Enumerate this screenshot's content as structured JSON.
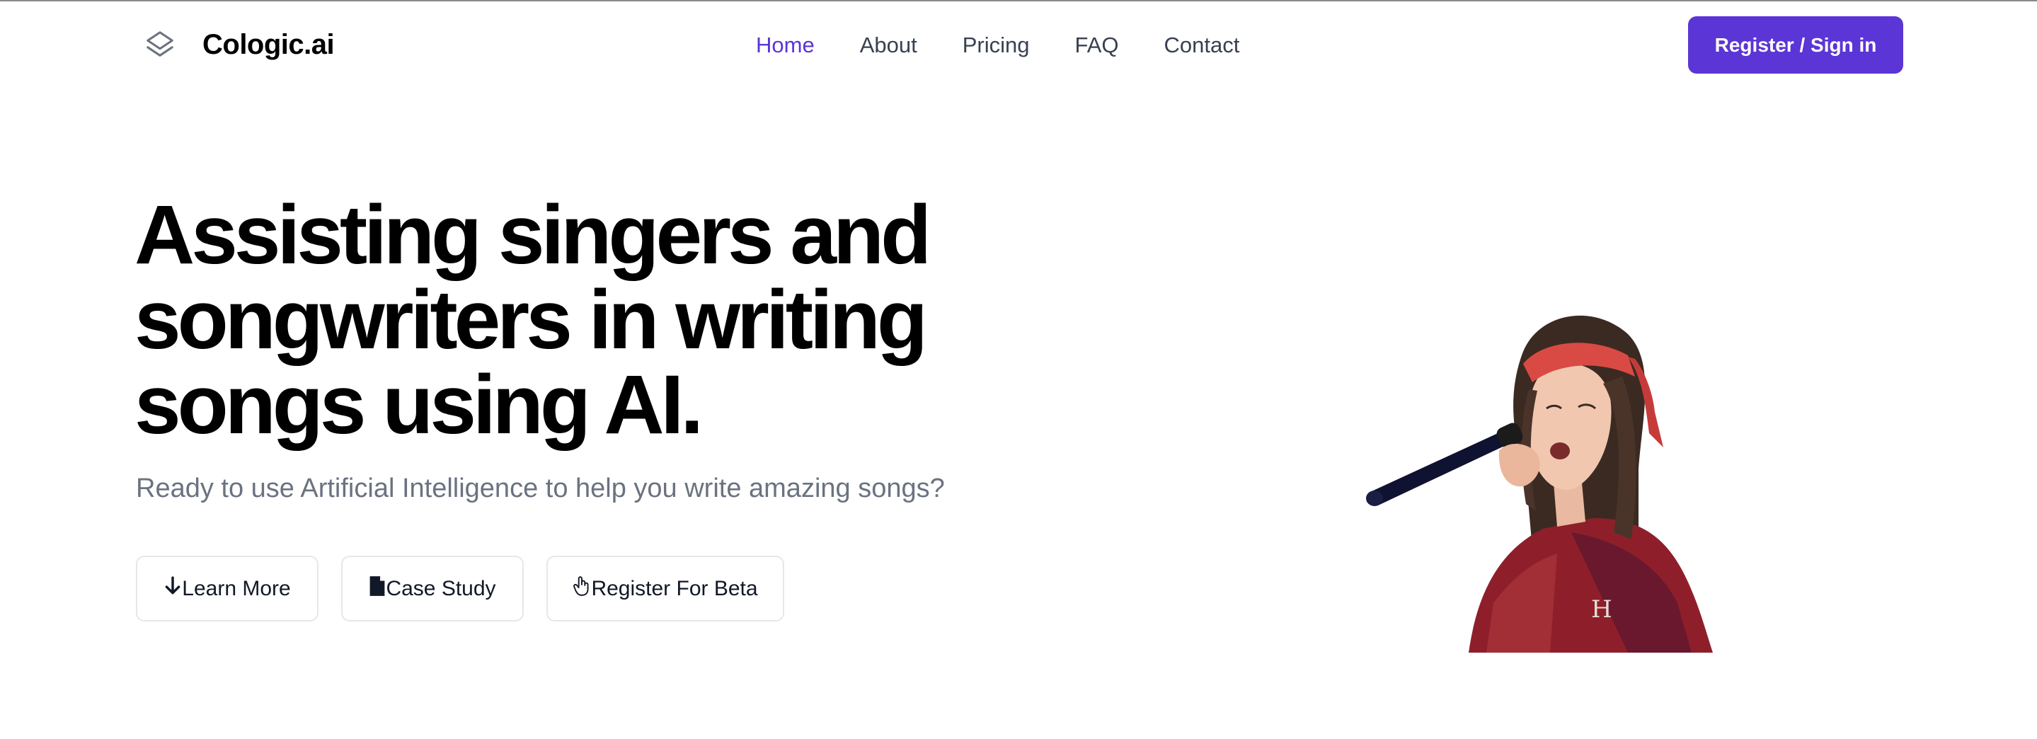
{
  "brand": {
    "name": "Cologic.ai",
    "icon": "layers-icon"
  },
  "nav": {
    "items": [
      {
        "label": "Home",
        "active": true
      },
      {
        "label": "About",
        "active": false
      },
      {
        "label": "Pricing",
        "active": false
      },
      {
        "label": "FAQ",
        "active": false
      },
      {
        "label": "Contact",
        "active": false
      }
    ],
    "cta_label": "Register / Sign in"
  },
  "hero": {
    "title_lines": [
      "Assisting singers and",
      "songwriters in writing",
      "songs using AI."
    ],
    "subtitle": "Ready to use Artificial Intelligence to help you write amazing songs?",
    "buttons": [
      {
        "label": "Learn More",
        "icon": "arrow-down-icon"
      },
      {
        "label": "Case Study",
        "icon": "document-icon"
      },
      {
        "label": "Register For Beta",
        "icon": "hand-pointer-icon"
      }
    ],
    "image": "singer-with-microphone"
  },
  "colors": {
    "accent": "#5b35d5",
    "title": "#000000",
    "subtitle": "#6b7280",
    "nav_text": "#374151",
    "button_border": "#e5e7eb"
  }
}
